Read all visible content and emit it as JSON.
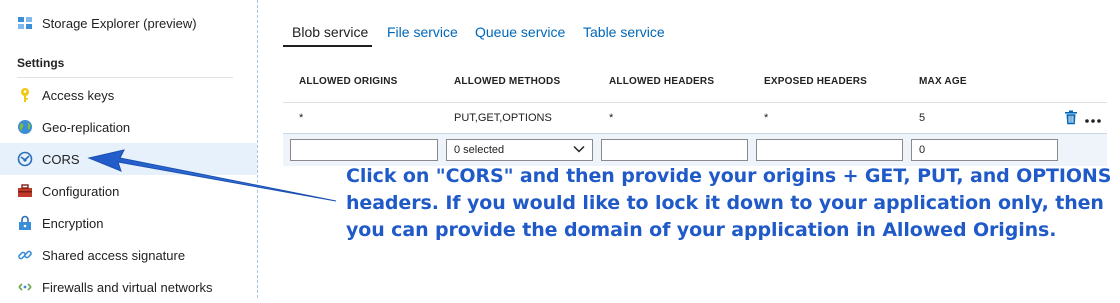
{
  "sidebar": {
    "top_item": {
      "label": "Storage Explorer (preview)",
      "icon": "storage-explorer-icon"
    },
    "section_title": "Settings",
    "items": [
      {
        "label": "Access keys",
        "icon": "key-icon"
      },
      {
        "label": "Geo-replication",
        "icon": "globe-icon"
      },
      {
        "label": "CORS",
        "icon": "cors-icon",
        "active": true
      },
      {
        "label": "Configuration",
        "icon": "toolbox-icon"
      },
      {
        "label": "Encryption",
        "icon": "lock-icon"
      },
      {
        "label": "Shared access signature",
        "icon": "link-icon"
      },
      {
        "label": "Firewalls and virtual networks",
        "icon": "network-icon"
      }
    ]
  },
  "tabs": [
    {
      "label": "Blob service",
      "active": true
    },
    {
      "label": "File service"
    },
    {
      "label": "Queue service"
    },
    {
      "label": "Table service"
    }
  ],
  "table": {
    "headers": [
      "ALLOWED ORIGINS",
      "ALLOWED METHODS",
      "ALLOWED HEADERS",
      "EXPOSED HEADERS",
      "MAX AGE"
    ],
    "row": [
      "*",
      "PUT,GET,OPTIONS",
      "*",
      "*",
      "5"
    ],
    "new_row": {
      "origins_value": "",
      "methods_value": "0 selected",
      "allowed_headers_value": "",
      "exposed_headers_value": "",
      "max_age_value": "0"
    }
  },
  "callout": {
    "text": "Click on \"CORS\" and then provide your origins + GET, PUT, and OPTIONS headers. If you would like to lock it down to your application only, then you can provide the domain of your application in Allowed Origins.",
    "color": "#1f5ac8"
  },
  "colors": {
    "accent": "#0067b8",
    "active_bg": "#e6f1fb",
    "delete_icon": "#0067b8"
  }
}
